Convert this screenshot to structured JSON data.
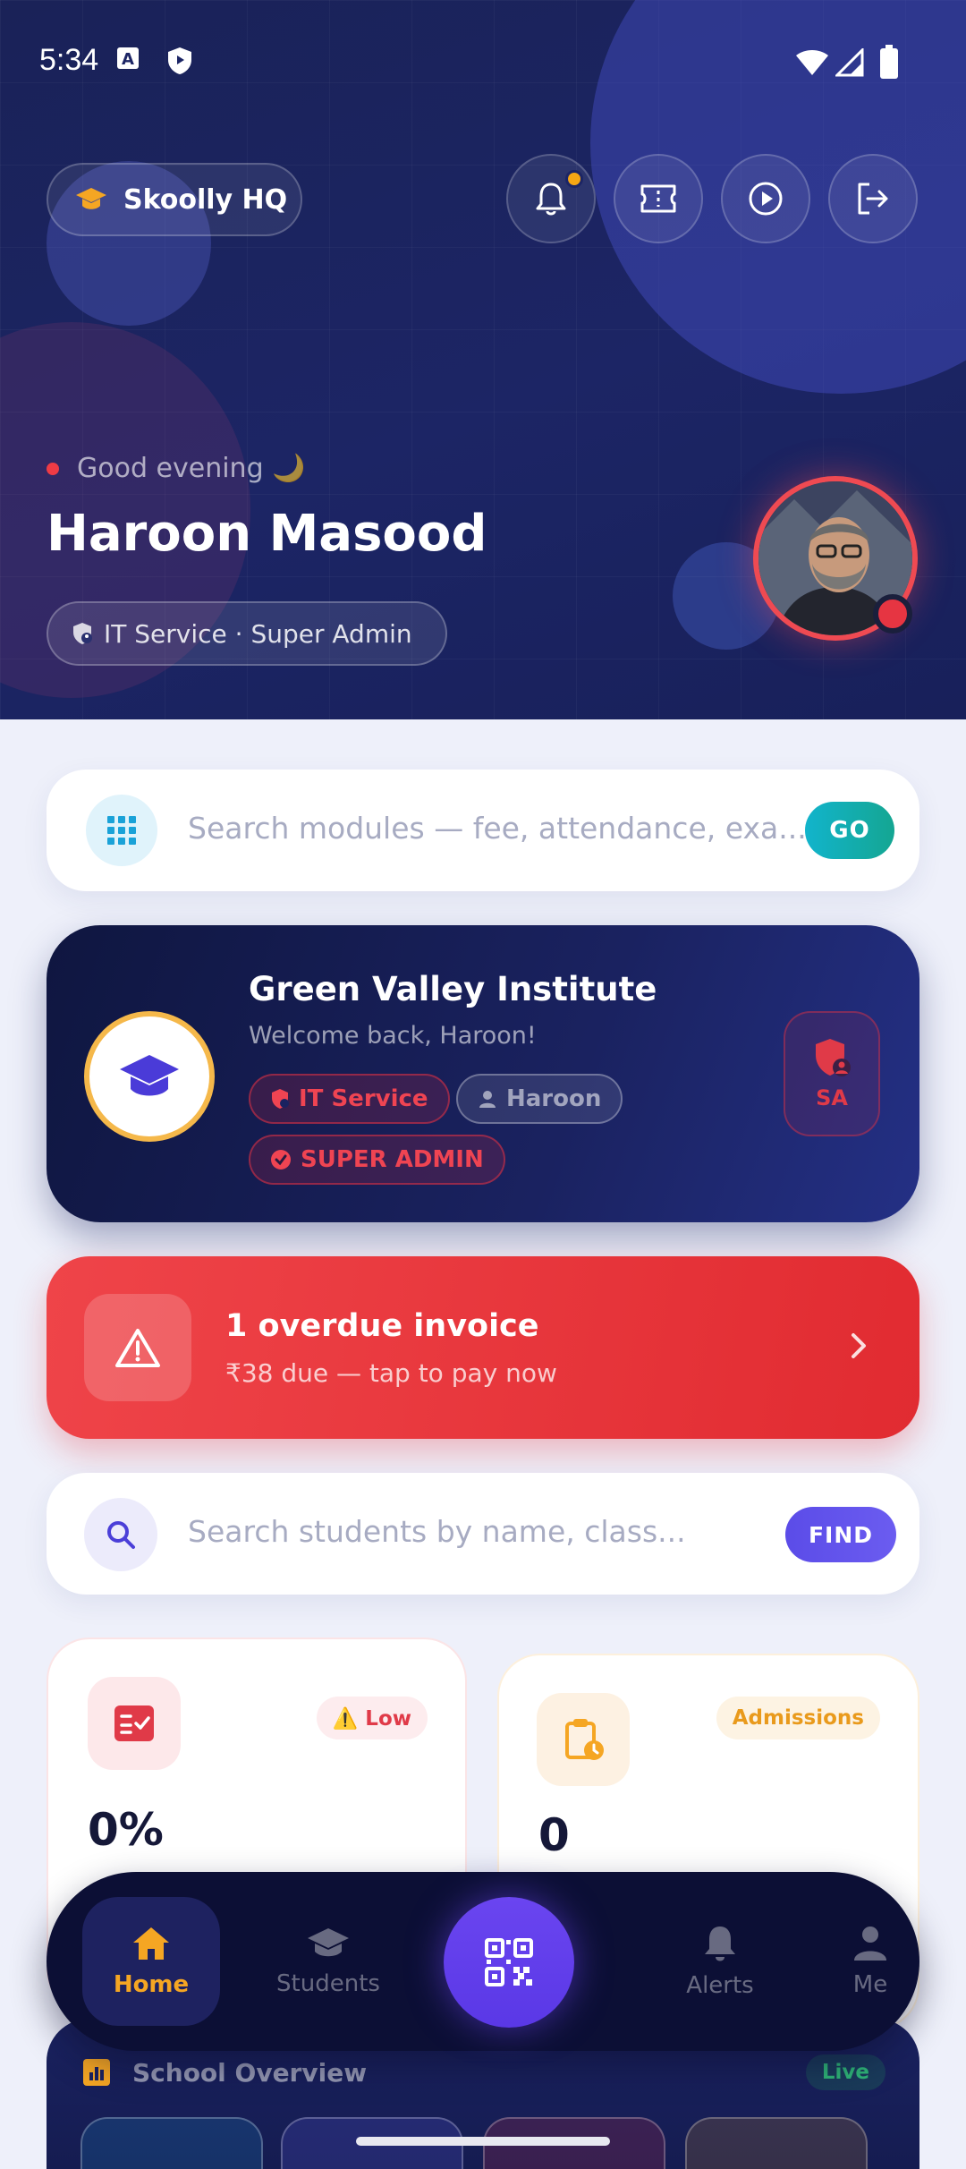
{
  "status_bar": {
    "time": "5:34"
  },
  "header": {
    "brand": "Skoolly HQ",
    "greeting": "Good evening 🌙",
    "user_name": "Haroon Masood",
    "role": "IT Service · Super Admin"
  },
  "module_search": {
    "placeholder": "Search modules — fee, attendance, exa...",
    "button": "GO"
  },
  "school_card": {
    "name": "Green Valley Institute",
    "welcome": "Welcome back, Haroon!",
    "tags": [
      "IT Service",
      "Haroon",
      "SUPER ADMIN"
    ],
    "badge": "SA"
  },
  "alert": {
    "title": "1 overdue invoice",
    "subtitle": "₹38 due — tap to pay now"
  },
  "student_search": {
    "placeholder": "Search students by name, class...",
    "button": "FIND"
  },
  "stats": [
    {
      "badge": "⚠️ Low",
      "value": "0%"
    },
    {
      "badge": "Admissions",
      "value": "0"
    }
  ],
  "overview": {
    "title": "School Overview",
    "status": "Live"
  },
  "bottom_nav": {
    "items": [
      "Home",
      "Students",
      "Alerts",
      "Me"
    ]
  },
  "colors": {
    "accent": "#f5a623",
    "danger": "#ef4449",
    "primary": "#5b4ce8",
    "navy": "#1a2258"
  },
  "icons": [
    "graduation-cap-icon",
    "bell-icon",
    "ticket-icon",
    "play-icon",
    "logout-icon",
    "grid-icon",
    "shield-icon",
    "user-icon",
    "verified-icon",
    "warning-icon",
    "chevron-right-icon",
    "search-icon",
    "checklist-icon",
    "clipboard-clock-icon",
    "bar-chart-icon",
    "home-icon",
    "qr-icon"
  ]
}
